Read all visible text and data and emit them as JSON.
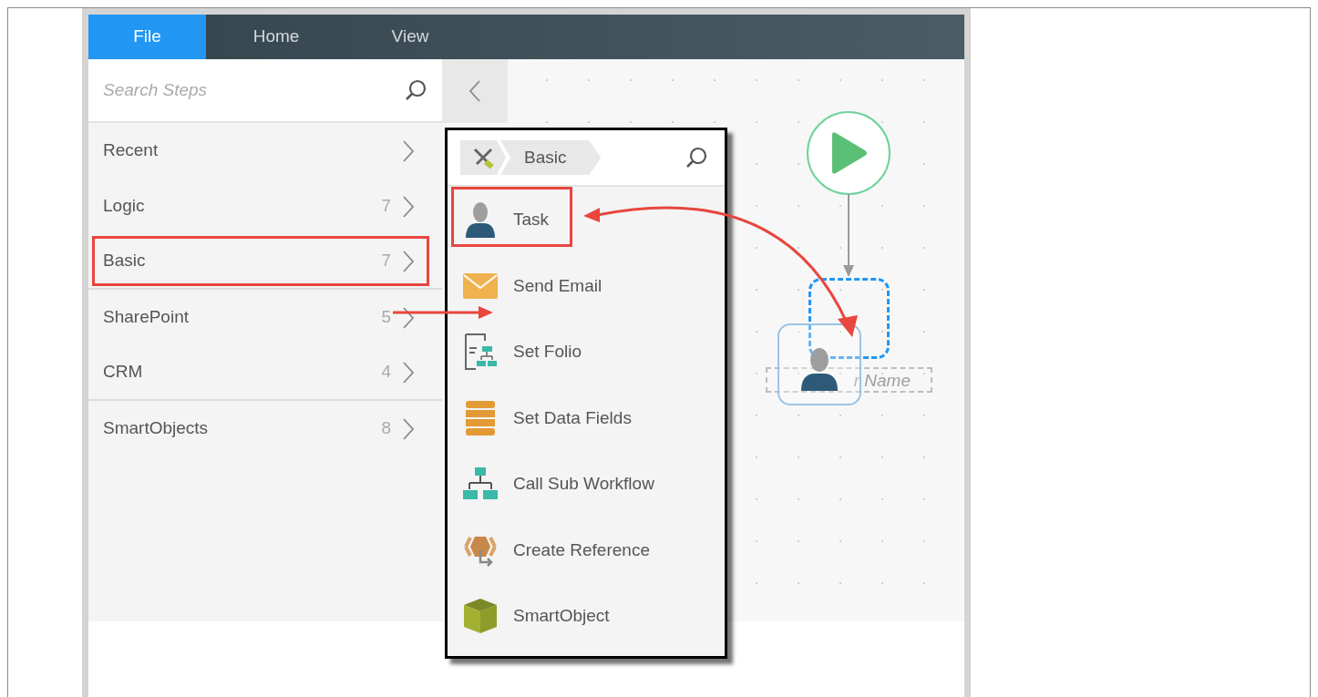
{
  "tabs": [
    {
      "label": "File",
      "selected": true
    },
    {
      "label": "Home",
      "selected": false
    },
    {
      "label": "View",
      "selected": false
    }
  ],
  "search": {
    "placeholder": "Search Steps"
  },
  "categories": [
    {
      "label": "Recent",
      "annotated": false,
      "divider_after": false
    },
    {
      "label": "Logic",
      "count": "7",
      "annotated": false,
      "divider_after": false
    },
    {
      "label": "Basic",
      "count": "7",
      "annotated": true,
      "divider_after": true
    },
    {
      "label": "SharePoint",
      "count": "5",
      "annotated": false,
      "divider_after": false
    },
    {
      "label": "CRM",
      "count": "4",
      "annotated": false,
      "divider_after": true
    },
    {
      "label": "SmartObjects",
      "count": "8",
      "annotated": false,
      "divider_after": false
    }
  ],
  "popup": {
    "breadcrumb": "Basic",
    "steps": [
      {
        "label": "Task",
        "kind": "person",
        "annotated": true
      },
      {
        "label": "Send Email",
        "kind": "envelope",
        "annotated": false
      },
      {
        "label": "Set Folio",
        "kind": "folio",
        "annotated": false
      },
      {
        "label": "Set Data Fields",
        "kind": "fields",
        "annotated": false
      },
      {
        "label": "Call Sub Workflow",
        "kind": "hierarchy",
        "annotated": false
      },
      {
        "label": "Create Reference",
        "kind": "reference",
        "annotated": false
      },
      {
        "label": "SmartObject",
        "kind": "cube",
        "annotated": false
      }
    ]
  },
  "canvas": {
    "task_name_text": "r Name"
  }
}
